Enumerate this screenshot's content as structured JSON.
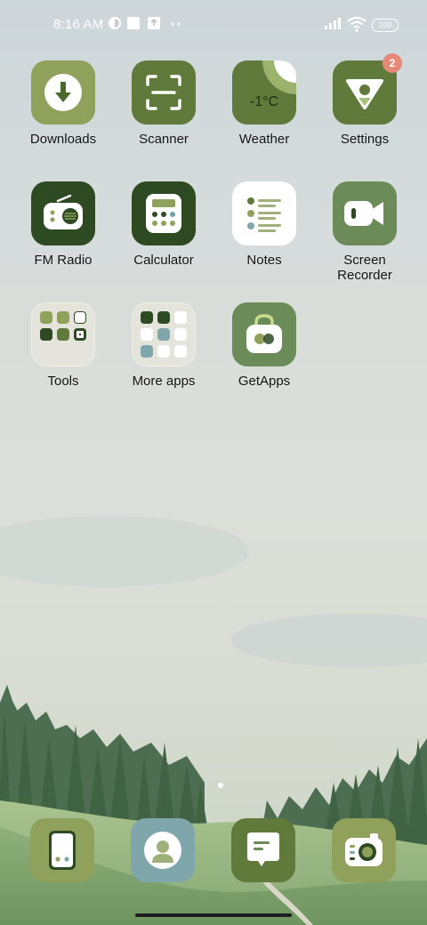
{
  "status_bar": {
    "time": "8:16 AM",
    "battery": "100",
    "icons": [
      "vpn-icon",
      "notification-square-icon",
      "download-notification-icon",
      "more-dots-icon",
      "signal-icon",
      "wifi-icon",
      "battery-icon"
    ]
  },
  "apps": [
    {
      "label": "Downloads",
      "icon": "download-icon"
    },
    {
      "label": "Scanner",
      "icon": "scan-frame-icon"
    },
    {
      "label": "Weather",
      "icon": "sun-icon",
      "temperature": "-1°C"
    },
    {
      "label": "Settings",
      "icon": "settings-icon",
      "badge": "2"
    },
    {
      "label": "FM Radio",
      "icon": "radio-icon"
    },
    {
      "label": "Calculator",
      "icon": "calculator-icon"
    },
    {
      "label": "Notes",
      "icon": "notes-list-icon"
    },
    {
      "label": "Screen Recorder",
      "icon": "video-camera-icon"
    },
    {
      "label": "Tools",
      "icon": "folder-icon"
    },
    {
      "label": "More apps",
      "icon": "folder-icon"
    },
    {
      "label": "GetApps",
      "icon": "shopping-bag-icon"
    }
  ],
  "dock": [
    {
      "icon": "phone-icon"
    },
    {
      "icon": "contacts-icon"
    },
    {
      "icon": "messages-icon"
    },
    {
      "icon": "camera-icon"
    }
  ],
  "colors": {
    "icon_light_green": "#8fa15a",
    "icon_mid_green": "#5f7a3a",
    "icon_dark_green": "#2d4a23",
    "icon_sage": "#6b8b58",
    "badge": "#e58a78",
    "dock_blue": "#7fa7ab"
  }
}
